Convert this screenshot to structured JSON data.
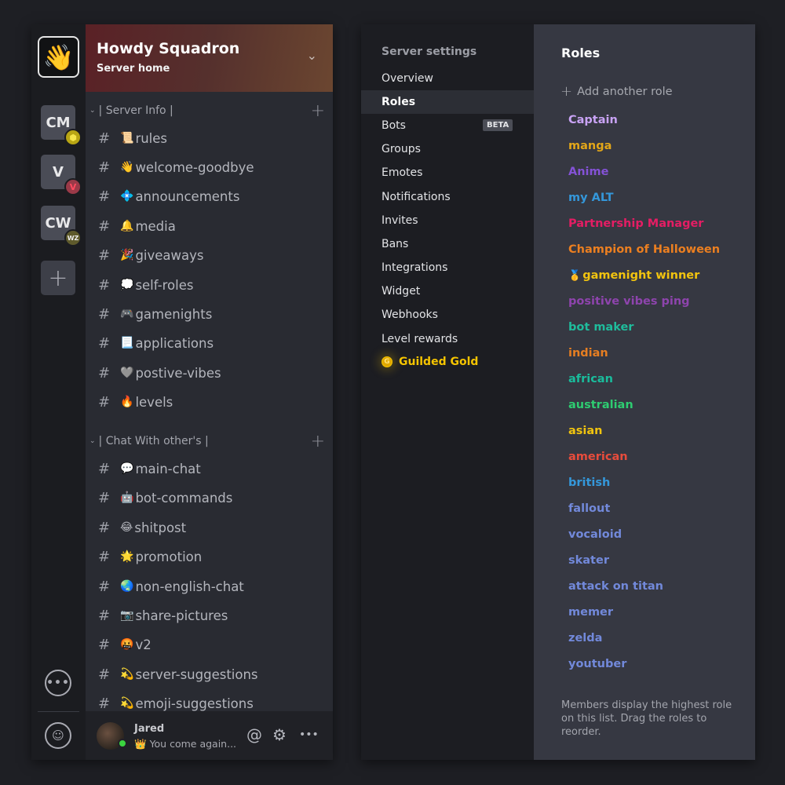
{
  "server_rail": {
    "home_icon": "waving-hand",
    "servers": [
      {
        "label": "CM",
        "badge_icon": "crown-hex-badge",
        "badge_color": "#b8a514"
      },
      {
        "label": "V",
        "badge_icon": "valorant-badge",
        "badge_color": "#9a3a48"
      },
      {
        "label": "CW",
        "badge_text": "WZ",
        "badge_color": "#5e5a2c"
      }
    ],
    "add_server_symbol": "+",
    "chat_icon_glyph": "•••",
    "friends_icon_glyph": "☺"
  },
  "server": {
    "name": "Howdy Squadron",
    "subtitle": "Server home",
    "chevron": "⌄"
  },
  "categories": [
    {
      "name": "| Server Info |",
      "channels": [
        {
          "emoji": "📜",
          "name": "rules"
        },
        {
          "emoji": "👋",
          "name": "welcome-goodbye"
        },
        {
          "emoji": "💠",
          "name": "announcements"
        },
        {
          "emoji": "🔔",
          "name": "media"
        },
        {
          "emoji": "🎉",
          "name": "giveaways"
        },
        {
          "emoji": "💭",
          "name": "self-roles"
        },
        {
          "emoji": "🎮",
          "name": "gamenights"
        },
        {
          "emoji": "📃",
          "name": "applications"
        },
        {
          "emoji": "🩶",
          "name": "postive-vibes"
        },
        {
          "emoji": "🔥",
          "name": "levels"
        }
      ]
    },
    {
      "name": "| Chat With other's |",
      "channels": [
        {
          "emoji": "💬",
          "name": "main-chat"
        },
        {
          "emoji": "🤖",
          "name": "bot-commands"
        },
        {
          "emoji": "😂",
          "name": "shitpost"
        },
        {
          "emoji": "🌟",
          "name": "promotion"
        },
        {
          "emoji": "🌏",
          "name": "non-english-chat"
        },
        {
          "emoji": "📷",
          "name": "share-pictures"
        },
        {
          "emoji": "🤬",
          "name": "v2"
        },
        {
          "emoji": "💫",
          "name": "server-suggestions"
        },
        {
          "emoji": "💫",
          "name": "emoji-suggestions"
        }
      ]
    }
  ],
  "user": {
    "name": "Jared",
    "status_emoji": "👑",
    "status_text": "You come again...",
    "presence": "online",
    "actions": {
      "mention": "@",
      "settings": "⚙",
      "more": "•••"
    }
  },
  "settings": {
    "heading": "Server settings",
    "nav": [
      {
        "label": "Overview"
      },
      {
        "label": "Roles",
        "active": true
      },
      {
        "label": "Bots",
        "badge": "BETA"
      },
      {
        "label": "Groups"
      },
      {
        "label": "Emotes"
      },
      {
        "label": "Notifications"
      },
      {
        "label": "Invites"
      },
      {
        "label": "Bans"
      },
      {
        "label": "Integrations"
      },
      {
        "label": "Widget"
      },
      {
        "label": "Webhooks"
      },
      {
        "label": "Level rewards"
      },
      {
        "label": "Guilded Gold",
        "icon": "G",
        "color": "#f5c400"
      }
    ]
  },
  "roles": {
    "title": "Roles",
    "add_label": "Add another role",
    "add_symbol": "+",
    "list": [
      {
        "name": "Captain",
        "color": "#c9a3f5"
      },
      {
        "name": "manga",
        "color": "#e2a619"
      },
      {
        "name": "Anime",
        "color": "#8452d6"
      },
      {
        "name": "my ALT",
        "color": "#3497da"
      },
      {
        "name": "Partnership Manager",
        "color": "#e51d64"
      },
      {
        "name": "Champion of Halloween",
        "color": "#ec7f20"
      },
      {
        "name": "gamenight winner",
        "color": "#f2c40f",
        "emoji": "🥇"
      },
      {
        "name": "positive vibes ping",
        "color": "#8e44ad"
      },
      {
        "name": "bot maker",
        "color": "#1fbc9c"
      },
      {
        "name": "indian",
        "color": "#e67e22"
      },
      {
        "name": "african",
        "color": "#1abc9c"
      },
      {
        "name": "australian",
        "color": "#2ecc71"
      },
      {
        "name": "asian",
        "color": "#f1c40f"
      },
      {
        "name": "american",
        "color": "#e74c3c"
      },
      {
        "name": "british",
        "color": "#3498db"
      },
      {
        "name": "fallout",
        "color": "#7289da"
      },
      {
        "name": "vocaloid",
        "color": "#7289da"
      },
      {
        "name": "skater",
        "color": "#7289da"
      },
      {
        "name": "attack on titan",
        "color": "#7289da"
      },
      {
        "name": "memer",
        "color": "#7289da"
      },
      {
        "name": "zelda",
        "color": "#7289da"
      },
      {
        "name": "youtuber",
        "color": "#7289da"
      }
    ],
    "footer": "Members display the highest role on this list. Drag the roles to reorder."
  }
}
